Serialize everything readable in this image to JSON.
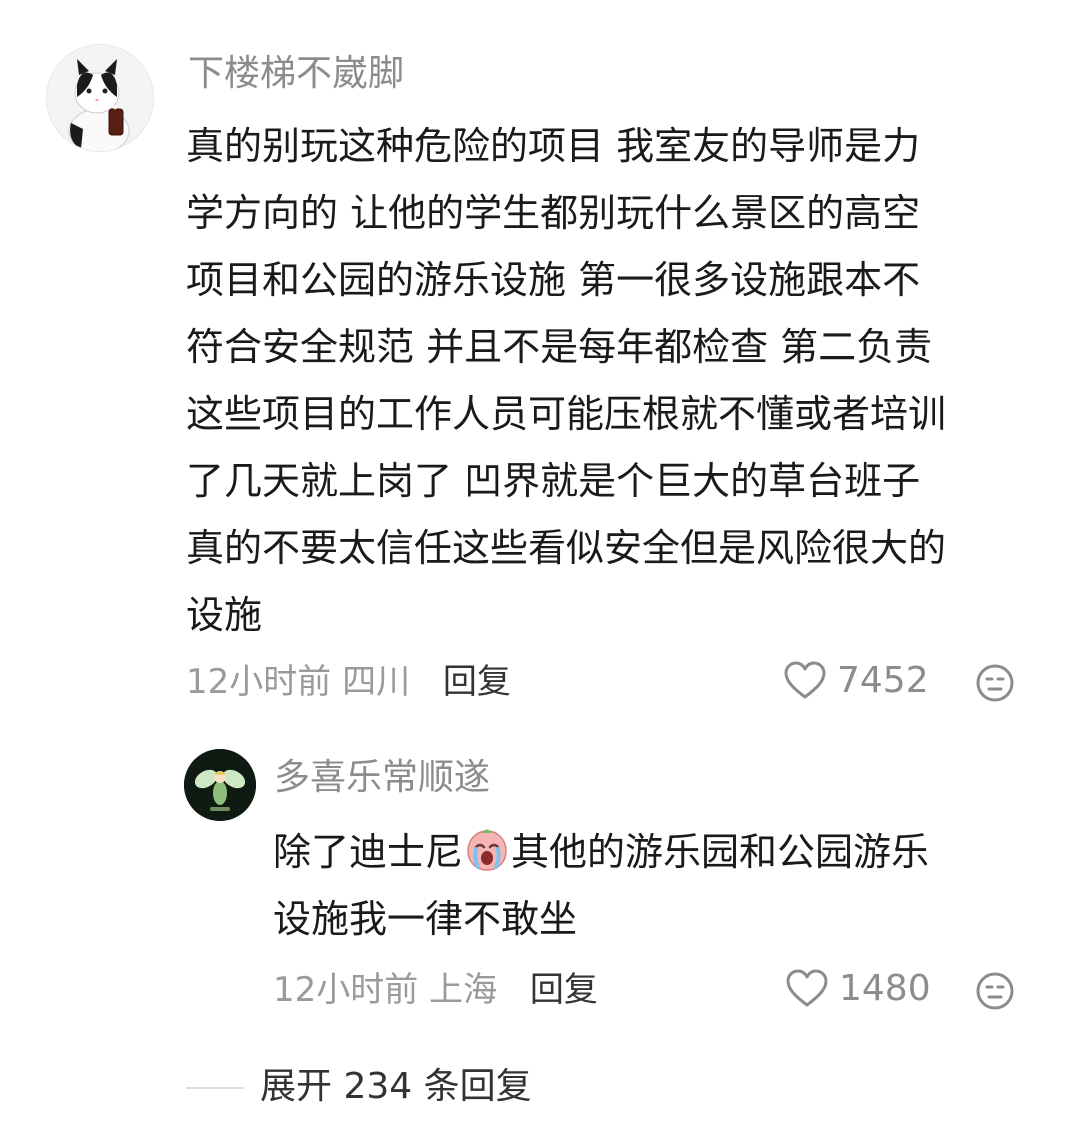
{
  "comments": [
    {
      "username": "下楼梯不崴脚",
      "avatar_icon": "cat-avatar-icon",
      "text_lines": [
        "真的别玩这种危险的项目 我室友的导师是力",
        "学方向的 让他的学生都别玩什么景区的高空",
        "项目和公园的游乐设施 第一很多设施跟本不",
        "符合安全规范 并且不是每年都检查 第二负责",
        "这些项目的工作人员可能压根就不懂或者培训",
        "了几天就上岗了 凹界就是个巨大的草台班子",
        "真的不要太信任这些看似安全但是风险很大的",
        "设施"
      ],
      "time": "12小时前",
      "location": "四川",
      "reply_label": "回复",
      "likes": "7452",
      "like_icon": "heart-outline-icon",
      "react_icon": "neutral-face-icon"
    }
  ],
  "reply": {
    "username": "多喜乐常顺遂",
    "avatar_icon": "fairy-avatar-icon",
    "text_part1": "除了迪士尼",
    "emoji_icon": "crying-face-emoji-icon",
    "text_part2": "其他的游乐园和公园游乐",
    "text_line2": "设施我一律不敢坐",
    "time": "12小时前",
    "location": "上海",
    "reply_label": "回复",
    "likes": "1480",
    "like_icon": "heart-outline-icon",
    "react_icon": "neutral-face-icon"
  },
  "expand_label": "展开 234 条回复",
  "colors": {
    "username": "#8c8c8c",
    "body_text": "#1a1a1a",
    "meta_text": "#9a9a9a",
    "action_text": "#333333"
  }
}
